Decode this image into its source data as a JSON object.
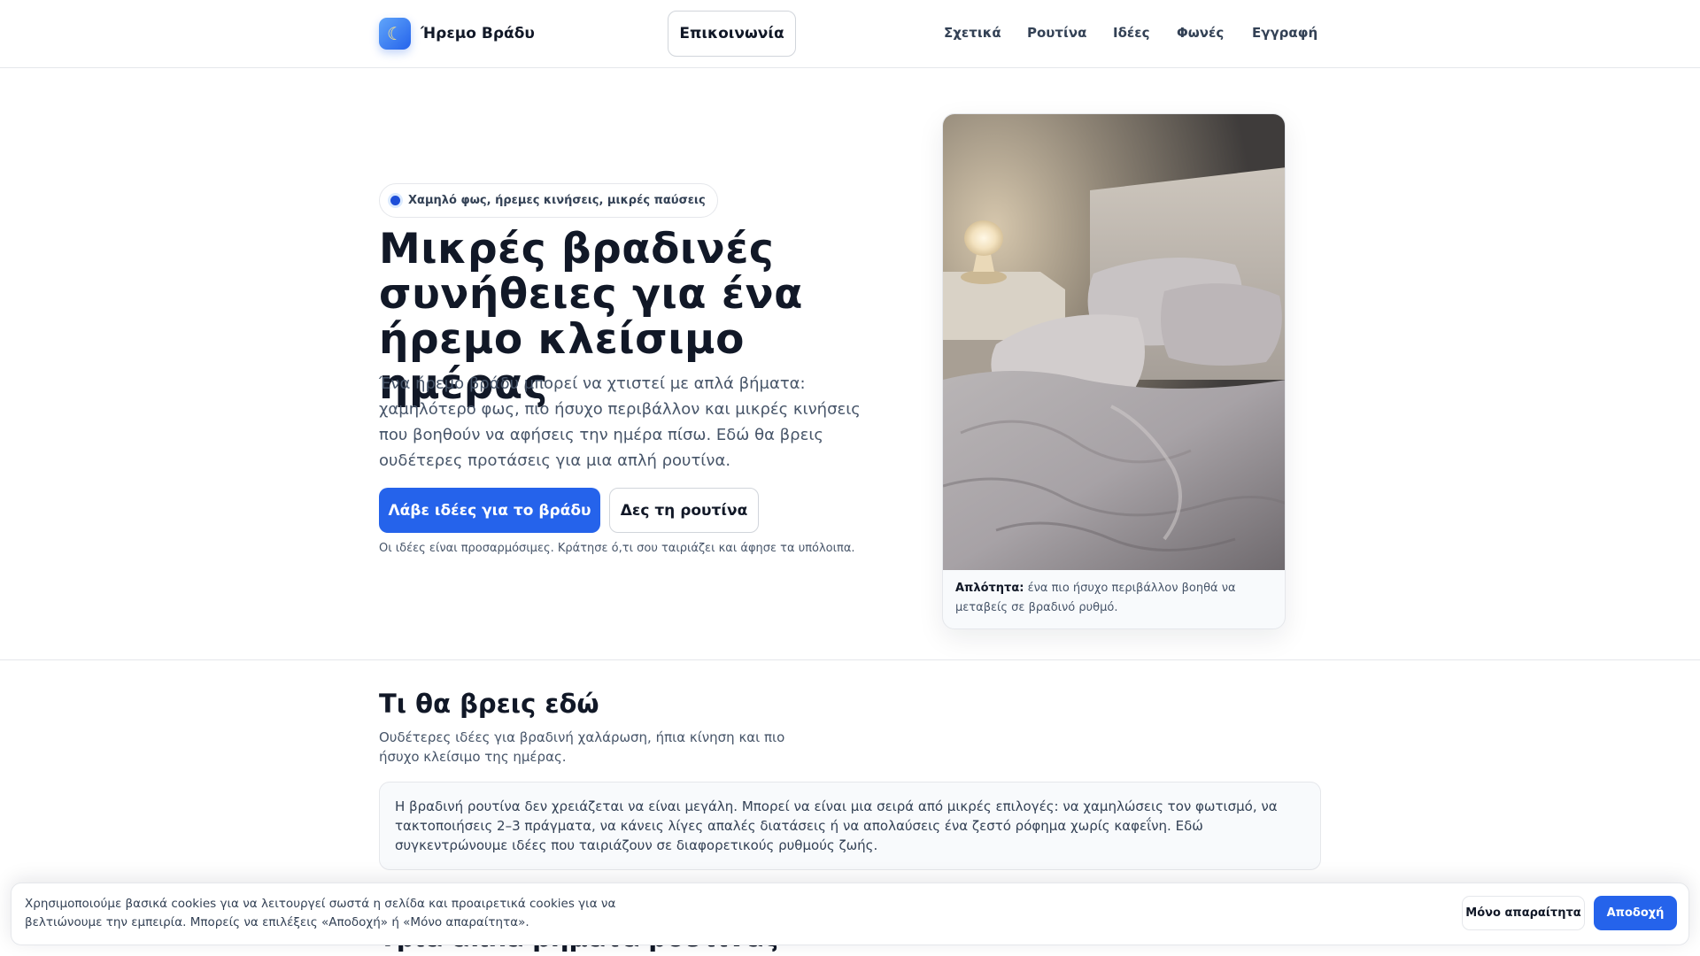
{
  "header": {
    "brand_icon": "moon-icon",
    "brand_name": "Ήρεμο Βράδυ",
    "contact_label": "Επικοινωνία",
    "nav": [
      "Σχετικά",
      "Ρουτίνα",
      "Ιδέες",
      "Φωνές",
      "Εγγραφή"
    ]
  },
  "hero": {
    "badge": "Χαμηλό φως, ήρεμες κινήσεις, μικρές παύσεις",
    "title": "Μικρές βραδινές συνήθειες για ένα ήρεμο κλείσιμο ημέρας",
    "lead": "Ένα ήρεμο βράδυ μπορεί να χτιστεί με απλά βήματα: χαμηλότερο φως, πιο ήσυχο περιβάλλον και μικρές κινήσεις που βοηθούν να αφήσεις την ημέρα πίσω. Εδώ θα βρεις ουδέτερες προτάσεις για μια απλή ρουτίνα.",
    "primary_cta": "Λάβε ιδέες για το βράδυ",
    "secondary_cta": "Δες τη ρουτίνα",
    "note": "Οι ιδέες είναι προσαρμόσιμες. Κράτησε ό,τι σου ταιριάζει και άφησε τα υπόλοιπα."
  },
  "image_card": {
    "caption_bold": "Απλότητα:",
    "caption_text": " ένα πιο ήσυχο περιβάλλον βοηθά να μεταβείς σε βραδινό ρυθμό."
  },
  "section": {
    "title": "Τι θα βρεις εδώ",
    "subtitle": "Ουδέτερες ιδέες για βραδινή χαλάρωση, ήπια κίνηση και πιο ήσυχο κλείσιμο της ημέρας.",
    "body": "Η βραδινή ρουτίνα δεν χρειάζεται να είναι μεγάλη. Μπορεί να είναι μια σειρά από μικρές επιλογές: να χαμηλώσεις τον φωτισμό, να τακτοποιήσεις 2–3 πράγματα, να κάνεις λίγες απαλές διατάσεις ή να απολαύσεις ένα ζεστό ρόφημα χωρίς καφεΐνη. Εδώ συγκεντρώνουμε ιδέες που ταιριάζουν σε διαφορετικούς ρυθμούς ζωής."
  },
  "section2": {
    "title": "Τρία απλά βήματα ρουτίνας"
  },
  "cookie": {
    "text": "Χρησιμοποιούμε βασικά cookies για να λειτουργεί σωστά η σελίδα και προαιρετικά cookies για να βελτιώνουμε την εμπειρία. Μπορείς να επιλέξεις «Αποδοχή» ή «Μόνο απαραίτητα».",
    "essential_label": "Μόνο απαραίτητα",
    "accept_label": "Αποδοχή"
  },
  "colors": {
    "accent": "#2563eb",
    "text": "#111827",
    "muted": "#475569",
    "border": "#e5e7eb"
  }
}
